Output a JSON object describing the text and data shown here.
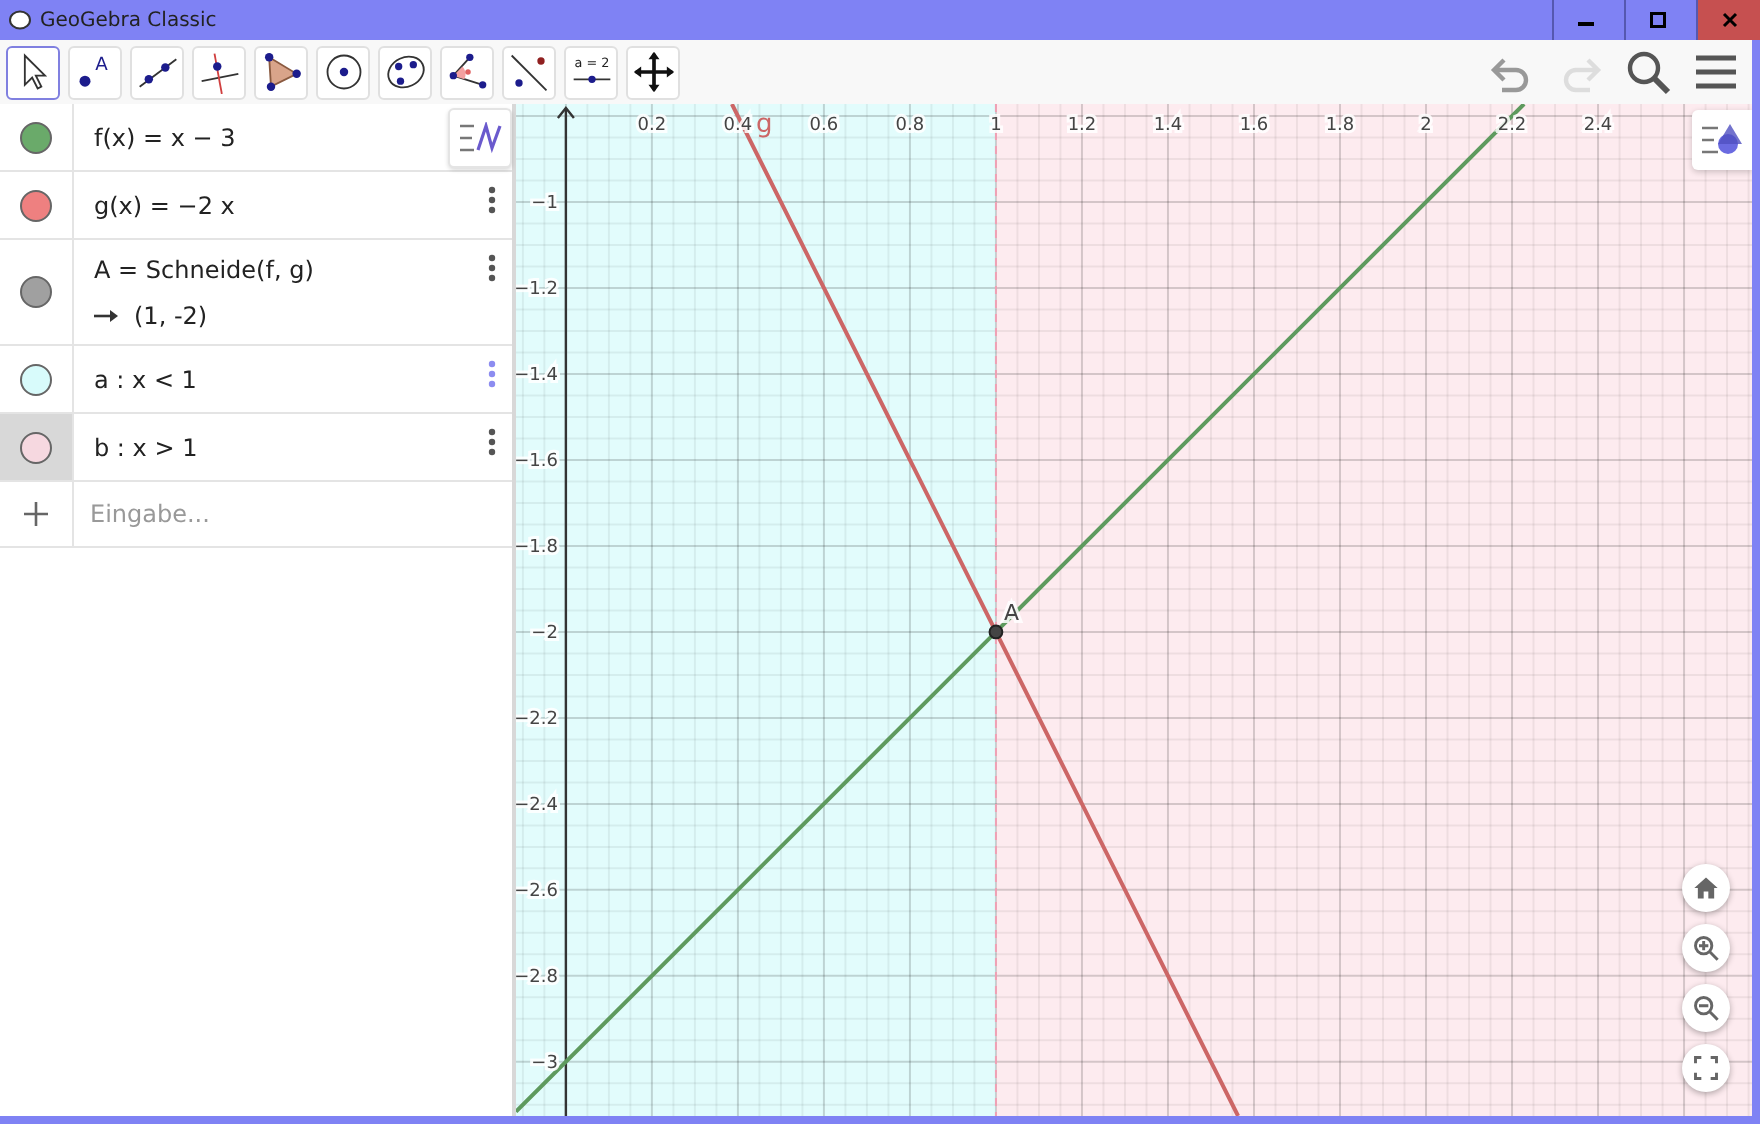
{
  "window": {
    "title": "GeoGebra Classic"
  },
  "toolbar": {
    "tools": [
      {
        "kind": "move",
        "selected": true
      },
      {
        "kind": "point",
        "glyph": "A",
        "selected": false
      },
      {
        "kind": "line",
        "selected": false
      },
      {
        "kind": "perpendicular",
        "selected": false
      },
      {
        "kind": "polygon",
        "selected": false
      },
      {
        "kind": "circle",
        "selected": false
      },
      {
        "kind": "conic",
        "selected": false
      },
      {
        "kind": "angle",
        "selected": false
      },
      {
        "kind": "reflect",
        "selected": false
      },
      {
        "kind": "slider",
        "glyph": "a = 2",
        "selected": false
      },
      {
        "kind": "pan",
        "selected": false
      }
    ],
    "actions": [
      {
        "kind": "undo",
        "disabled": false
      },
      {
        "kind": "redo",
        "disabled": true
      },
      {
        "kind": "search"
      },
      {
        "kind": "menu"
      }
    ]
  },
  "algebra": {
    "items": [
      {
        "definition": "f(x) = x − 3",
        "color": "#6aaa6a",
        "selected": false
      },
      {
        "definition": "g(x) = −2 x",
        "color": "#ee8080",
        "selected": false,
        "menu": true,
        "hovered": false
      },
      {
        "definition": "A = Schneide(f, g)",
        "output": "(1, -2)",
        "color": "#a0a0a0",
        "selected": false,
        "menu": true,
        "hovered": false
      },
      {
        "definition": "a : x < 1",
        "color": "#d8fbfb",
        "selected": false,
        "menu": true,
        "hovered": true
      },
      {
        "definition": "b : x > 1",
        "color": "#f6d8e0",
        "selected": true,
        "menu": true,
        "hovered": false
      }
    ],
    "input": {
      "placeholder": "Eingabe..."
    }
  },
  "graphics": {
    "chart_data": {
      "type": "line",
      "x": [
        -0.116,
        0.386,
        1,
        1.563,
        2.228
      ],
      "series": [
        {
          "color": "#5e9a5e",
          "values": [
            -3.116,
            -2.614,
            -2,
            -1.437,
            -0.772
          ]
        },
        {
          "name": "g",
          "color": "#cc6666",
          "values": [
            null,
            -0.772,
            -2,
            -3.126,
            null
          ]
        }
      ],
      "xlim": [
        -0.116,
        2.758
      ],
      "ylim": [
        -3.126,
        -0.772
      ],
      "grid": true,
      "xticks": [
        0.2,
        0.4,
        0.6,
        0.8,
        1,
        1.2,
        1.4,
        1.6,
        1.8,
        2,
        2.2,
        2.4
      ],
      "yticks": [
        {
          "value": -1,
          "label": "−1"
        },
        {
          "value": -1.2,
          "label": "−1.2"
        },
        {
          "value": -1.4,
          "label": "−1.4"
        },
        {
          "value": -1.6,
          "label": "−1.6"
        },
        {
          "value": -1.8,
          "label": "−1.8"
        },
        {
          "value": -2,
          "label": "−2"
        },
        {
          "value": -2.2,
          "label": "−2.2"
        },
        {
          "value": -2.4,
          "label": "−2.4"
        },
        {
          "value": -2.6,
          "label": "−2.6"
        },
        {
          "value": -2.8,
          "label": "−2.8"
        },
        {
          "value": -3,
          "label": "−3"
        }
      ],
      "bands": [
        {
          "axis": "x",
          "from": -0.116,
          "to": 1,
          "color": "#e2fcfc"
        },
        {
          "axis": "x",
          "from": 1,
          "to": 2.758,
          "color": "#fdebef"
        }
      ],
      "ref_lines": [
        {
          "axis": "x",
          "value": 1,
          "color": "#f0a0b4"
        }
      ],
      "annotations": [
        {
          "text": "A",
          "x": 1,
          "y": -2
        }
      ]
    },
    "zoom_buttons": [
      {
        "kind": "home"
      },
      {
        "kind": "zoom_in"
      },
      {
        "kind": "zoom_out"
      },
      {
        "kind": "fullscreen"
      }
    ]
  }
}
